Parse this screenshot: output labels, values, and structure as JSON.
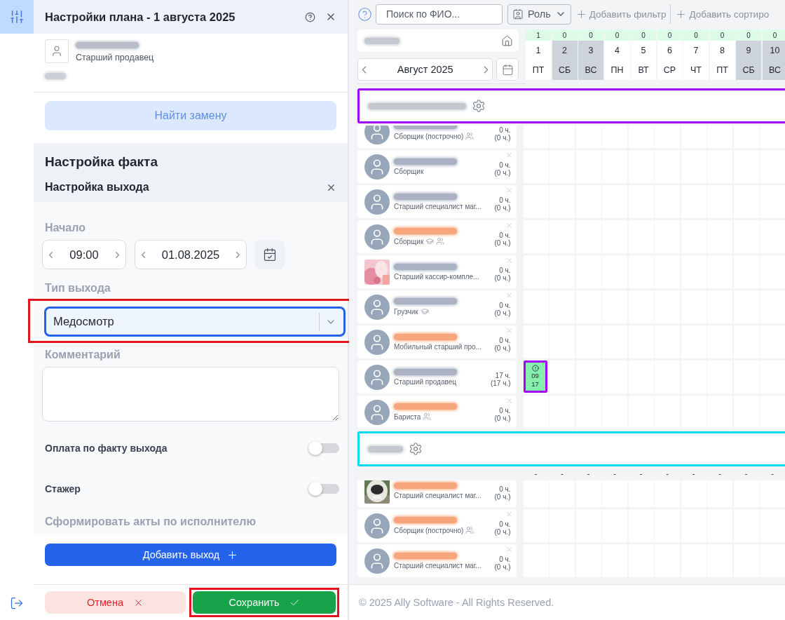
{
  "rail": [
    {
      "kind": "sliders",
      "selected": true
    },
    {
      "kind": "logout",
      "selected": false
    }
  ],
  "panel": {
    "title": "Настройки плана - 1 августа 2025",
    "employee": {
      "role": "Старший продавец"
    },
    "replace_button": {
      "label": "Найти замену",
      "disabled": true
    },
    "fact_title": "Настройка факта",
    "exit_section": {
      "title": "Настройка выхода",
      "start_label": "Начало",
      "time": "09:00",
      "date": "01.08.2025",
      "type_label": "Тип выхода",
      "type_value": "Медосмотр",
      "type_highlighted": true,
      "comment_label": "Комментарий",
      "toggles": [
        {
          "label": "Оплата по факту выхода",
          "on": false
        },
        {
          "label": "Стажер",
          "on": false
        }
      ],
      "acts_label": "Сформировать акты по исполнителю"
    },
    "add_button": "Добавить выход",
    "cancel_button": "Отмена",
    "save_button": {
      "label": "Сохранить",
      "highlighted": true
    }
  },
  "toolbar": {
    "search_placeholder": "Поиск по ФИО...",
    "role_filter": "Роль",
    "add_filter": "Добавить фильтр",
    "add_sort": "Добавить сортиро"
  },
  "month": "Август 2025",
  "days": [
    {
      "count": "1",
      "day": "1",
      "weekday": "ПТ",
      "weekend": false
    },
    {
      "count": "0",
      "day": "2",
      "weekday": "СБ",
      "weekend": true
    },
    {
      "count": "0",
      "day": "3",
      "weekday": "ВС",
      "weekend": true
    },
    {
      "count": "0",
      "day": "4",
      "weekday": "ПН",
      "weekend": false
    },
    {
      "count": "0",
      "day": "5",
      "weekday": "ВТ",
      "weekend": false
    },
    {
      "count": "0",
      "day": "6",
      "weekday": "СР",
      "weekend": false
    },
    {
      "count": "0",
      "day": "7",
      "weekday": "ЧТ",
      "weekend": false
    },
    {
      "count": "0",
      "day": "8",
      "weekday": "ПТ",
      "weekend": false
    },
    {
      "count": "0",
      "day": "9",
      "weekday": "СБ",
      "weekend": true
    },
    {
      "count": "0",
      "day": "10",
      "weekday": "ВС",
      "weekend": true
    }
  ],
  "groups": [
    {
      "color": "#a100f2",
      "employees": [
        {
          "kind": "default",
          "color": "#a9b1c2",
          "role": "Сборщик (построчно)",
          "badges": [
            {
              "kind": "team"
            }
          ],
          "hours": "0 ч.",
          "planned": "(0 ч.)"
        },
        {
          "kind": "default",
          "color": "#a9b1c2",
          "role": "Сборщик",
          "hours": "0 ч.",
          "planned": "(0 ч.)",
          "removable": true
        },
        {
          "kind": "default",
          "color": "#a9b1c2",
          "role": "Старший специалист маг...",
          "hours": "0 ч.",
          "planned": "(0 ч.)",
          "removable": true
        },
        {
          "kind": "default",
          "color": "#f7a57a",
          "role": "Сборщик",
          "badges": [
            {
              "kind": "trainee"
            },
            {
              "kind": "team"
            }
          ],
          "hours": "0 ч.",
          "planned": "(0 ч.)",
          "removable": true
        },
        {
          "color": "#a9b1c2",
          "role": "Старший кассир-компле...",
          "hours": "0 ч.",
          "planned": "(0 ч.)",
          "removable": true
        },
        {
          "kind": "default",
          "color": "#a9b1c2",
          "role": "Грузчик",
          "badges": [
            {
              "kind": "trainee"
            }
          ],
          "hours": "0 ч.",
          "planned": "(0 ч.)",
          "removable": true
        },
        {
          "kind": "default",
          "color": "#f7a57a",
          "role": "Мобильный старший про...",
          "hours": "0 ч.",
          "planned": "(0 ч.)",
          "removable": true
        },
        {
          "kind": "default",
          "color": "#a9b1c2",
          "role": "Старший продавец",
          "hours": "17 ч.",
          "planned": "(17 ч.)",
          "removable": false,
          "cells": [
            {
              "kind": "shift",
              "start": "09",
              "end": "17",
              "warning": true
            },
            {
              "kind": "empty"
            },
            {
              "kind": "empty"
            },
            {
              "kind": "empty"
            },
            {
              "kind": "empty"
            },
            {
              "kind": "empty"
            },
            {
              "kind": "empty"
            },
            {
              "kind": "empty"
            },
            {
              "kind": "empty"
            },
            {
              "kind": "empty"
            }
          ]
        },
        {
          "kind": "default",
          "color": "#f7a57a",
          "role": "Бариста",
          "badges": [
            {
              "kind": "team"
            }
          ],
          "hours": "0 ч.",
          "planned": "(0 ч.)",
          "removable": true
        }
      ]
    },
    {
      "color": "#00dcef",
      "totals": [
        "-",
        "-",
        "-",
        "-",
        "-",
        "-",
        "-",
        "-",
        "-",
        "-"
      ],
      "employees": [
        {
          "color": "#f7a57a",
          "role": "Старший специалист маг...",
          "hours": "0 ч.",
          "planned": "(0 ч.)"
        },
        {
          "kind": "default",
          "color": "#f7a57a",
          "role": "Сборщик (построчно)",
          "badges": [
            {
              "kind": "team"
            }
          ],
          "hours": "0 ч.",
          "planned": "(0 ч.)",
          "removable": true
        },
        {
          "kind": "default",
          "color": "#f7a57a",
          "role": "Старший специалист маг...",
          "hours": "0 ч.",
          "planned": "(0 ч.)",
          "removable": true
        }
      ]
    }
  ],
  "footer": "© 2025 Ally Software - All Rights Reserved."
}
